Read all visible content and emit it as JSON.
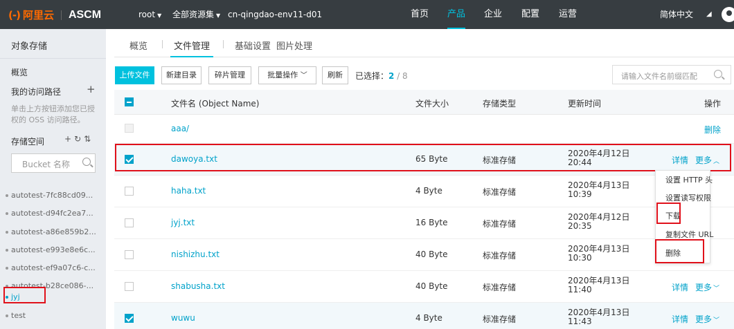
{
  "topbar": {
    "logo_mark": "(-)",
    "logo_text": "阿里云",
    "app_name": "ASCM",
    "user": "root",
    "resource_set": "全部资源集",
    "region": "cn-qingdao-env11-d01",
    "nav": [
      "首页",
      "产品",
      "企业",
      "配置",
      "运营"
    ],
    "language": "简体中文"
  },
  "sidebar": {
    "title": "对象存储",
    "overview": "概览",
    "my_paths": "我的访问路径",
    "paths_hint": "单击上方按钮添加您已授权的 OSS 访问路径。",
    "storage_space": "存储空间",
    "bucket_search_placeholder": "Bucket 名称",
    "buckets": [
      "autotest-7fc88cd09...",
      "autotest-d94fc2ea7...",
      "autotest-a86e859b2...",
      "autotest-e993e8e6c...",
      "autotest-ef9a07c6-c...",
      "autotest-b28ce086-...",
      "jyj",
      "test"
    ]
  },
  "tabs": [
    "概览",
    "文件管理",
    "基础设置",
    "图片处理"
  ],
  "toolbar": {
    "upload": "上传文件",
    "new_dir": "新建目录",
    "fragments": "碎片管理",
    "batch": "批量操作",
    "refresh": "刷新",
    "selected_label": "已选择：",
    "selected_count": "2",
    "selected_total": "/ 8",
    "search_placeholder": "请输入文件名前缀匹配"
  },
  "table": {
    "headers": [
      "文件名 (Object Name)",
      "文件大小",
      "存储类型",
      "更新时间",
      "操作"
    ],
    "rows": [
      {
        "name": "aaa/",
        "size": "",
        "type": "",
        "date": "",
        "time": "",
        "op1": "",
        "op2": "删除"
      },
      {
        "name": "dawoya.txt",
        "size": "65 Byte",
        "type": "标准存储",
        "date": "2020年4月12日",
        "time": "20:44",
        "op1": "详情",
        "op2": "更多"
      },
      {
        "name": "haha.txt",
        "size": "4 Byte",
        "type": "标准存储",
        "date": "2020年4月13日",
        "time": "10:39",
        "op1": "",
        "op2": ""
      },
      {
        "name": "jyj.txt",
        "size": "16 Byte",
        "type": "标准存储",
        "date": "2020年4月12日",
        "time": "20:35",
        "op1": "",
        "op2": ""
      },
      {
        "name": "nishizhu.txt",
        "size": "40 Byte",
        "type": "标准存储",
        "date": "2020年4月13日",
        "time": "10:30",
        "op1": "",
        "op2": ""
      },
      {
        "name": "shabusha.txt",
        "size": "40 Byte",
        "type": "标准存储",
        "date": "2020年4月13日",
        "time": "11:40",
        "op1": "详情",
        "op2": "更多"
      },
      {
        "name": "wuwu",
        "size": "4 Byte",
        "type": "标准存储",
        "date": "2020年4月13日",
        "time": "11:43",
        "op1": "详情",
        "op2": "更多"
      }
    ]
  },
  "more_menu": [
    "设置 HTTP 头",
    "设置读写权限",
    "下载",
    "复制文件 URL",
    "删除"
  ]
}
